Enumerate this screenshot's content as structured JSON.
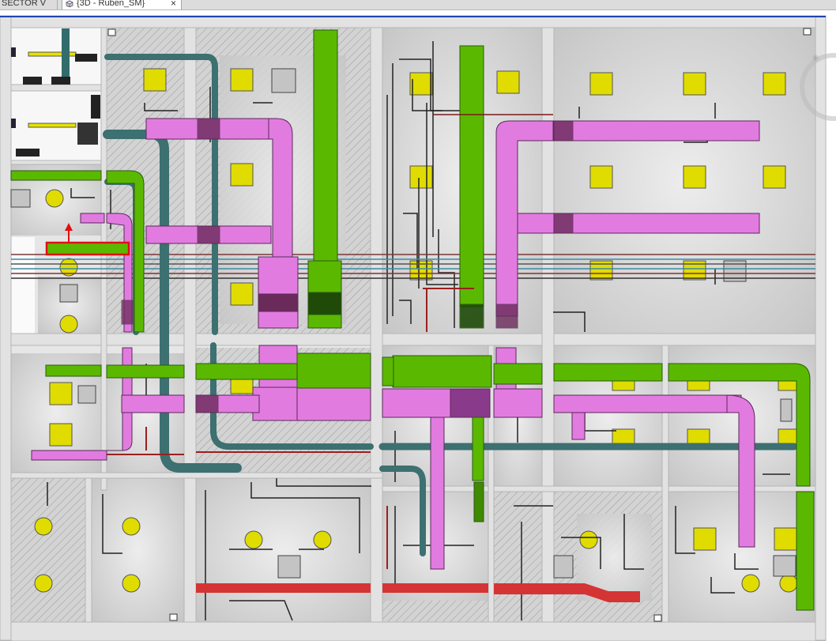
{
  "tabs": [
    {
      "label": "SECTOR V",
      "active": false
    },
    {
      "label": "{3D - Ruben_SM}",
      "active": true
    }
  ],
  "close_glyph": "×",
  "icons": {
    "view3d": "3d-view-icon",
    "close": "close-icon",
    "viewcube": "viewcube-icon"
  },
  "colors": {
    "background": "#ffffff",
    "room_floor": "#d9d9d9",
    "wall": "#e4e4e4",
    "duct_supply": "#e27be0",
    "duct_return": "#5bb800",
    "pipe_teal": "#3d7070",
    "pipe_red": "#d43434",
    "cable": "#222222",
    "light_fixture": "#e0dc00",
    "selection": "#e01010"
  }
}
